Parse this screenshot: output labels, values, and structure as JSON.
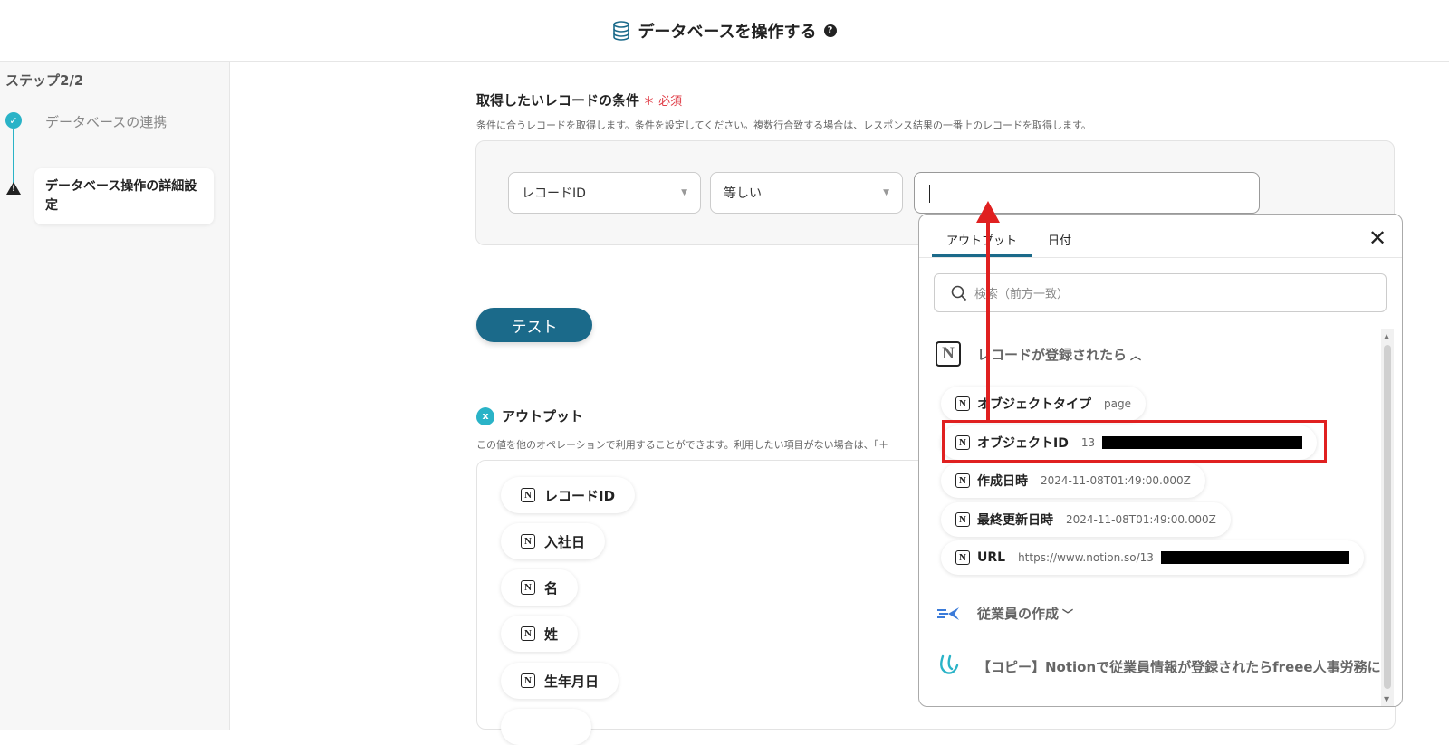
{
  "header": {
    "title": "データベースを操作する",
    "help": "?"
  },
  "sidebar": {
    "step_label": "ステップ2/2",
    "steps": [
      {
        "label": "データベースの連携",
        "status": "done"
      },
      {
        "label": "データベース操作の詳細設定",
        "status": "warning"
      }
    ]
  },
  "condition": {
    "title": "取得したいレコードの条件",
    "required_mark": "＊",
    "required": "必須",
    "description": "条件に合うレコードを取得します。条件を設定してください。複数行合致する場合は、レスポンス結果の一番上のレコードを取得します。",
    "field": "レコードID",
    "operator": "等しい",
    "value": ""
  },
  "test_button": "テスト",
  "output": {
    "title": "アウトプット",
    "description": "この値を他のオペレーションで利用することができます。利用したい項目がない場合は、「＋",
    "items": [
      "レコードID",
      "入社日",
      "名",
      "姓",
      "生年月日"
    ]
  },
  "popup": {
    "tabs": [
      "アウトプット",
      "日付"
    ],
    "active_tab": "アウトプット",
    "search_placeholder": "検索（前方一致）",
    "groups": [
      {
        "title": "レコードが登録されたら",
        "expanded": true
      },
      {
        "title": "従業員の作成",
        "expanded": false
      },
      {
        "title": "【コピー】Notionで従業員情報が登録されたらfreee人事労務にも"
      }
    ],
    "items": [
      {
        "label": "オブジェクトタイプ",
        "value": "page"
      },
      {
        "label": "オブジェクトID",
        "value": "13"
      },
      {
        "label": "作成日時",
        "value": "2024-11-08T01:49:00.000Z"
      },
      {
        "label": "最終更新日時",
        "value": "2024-11-08T01:49:00.000Z"
      },
      {
        "label": "URL",
        "value": "https://www.notion.so/13"
      }
    ]
  },
  "icons": {
    "notion": "N",
    "check": "✓",
    "warning": "!",
    "close": "✕",
    "search": "search-icon"
  },
  "colors": {
    "accent": "#1b6a8a",
    "teal": "#2ab3c7",
    "red": "#e02020",
    "required": "#e0404a"
  }
}
